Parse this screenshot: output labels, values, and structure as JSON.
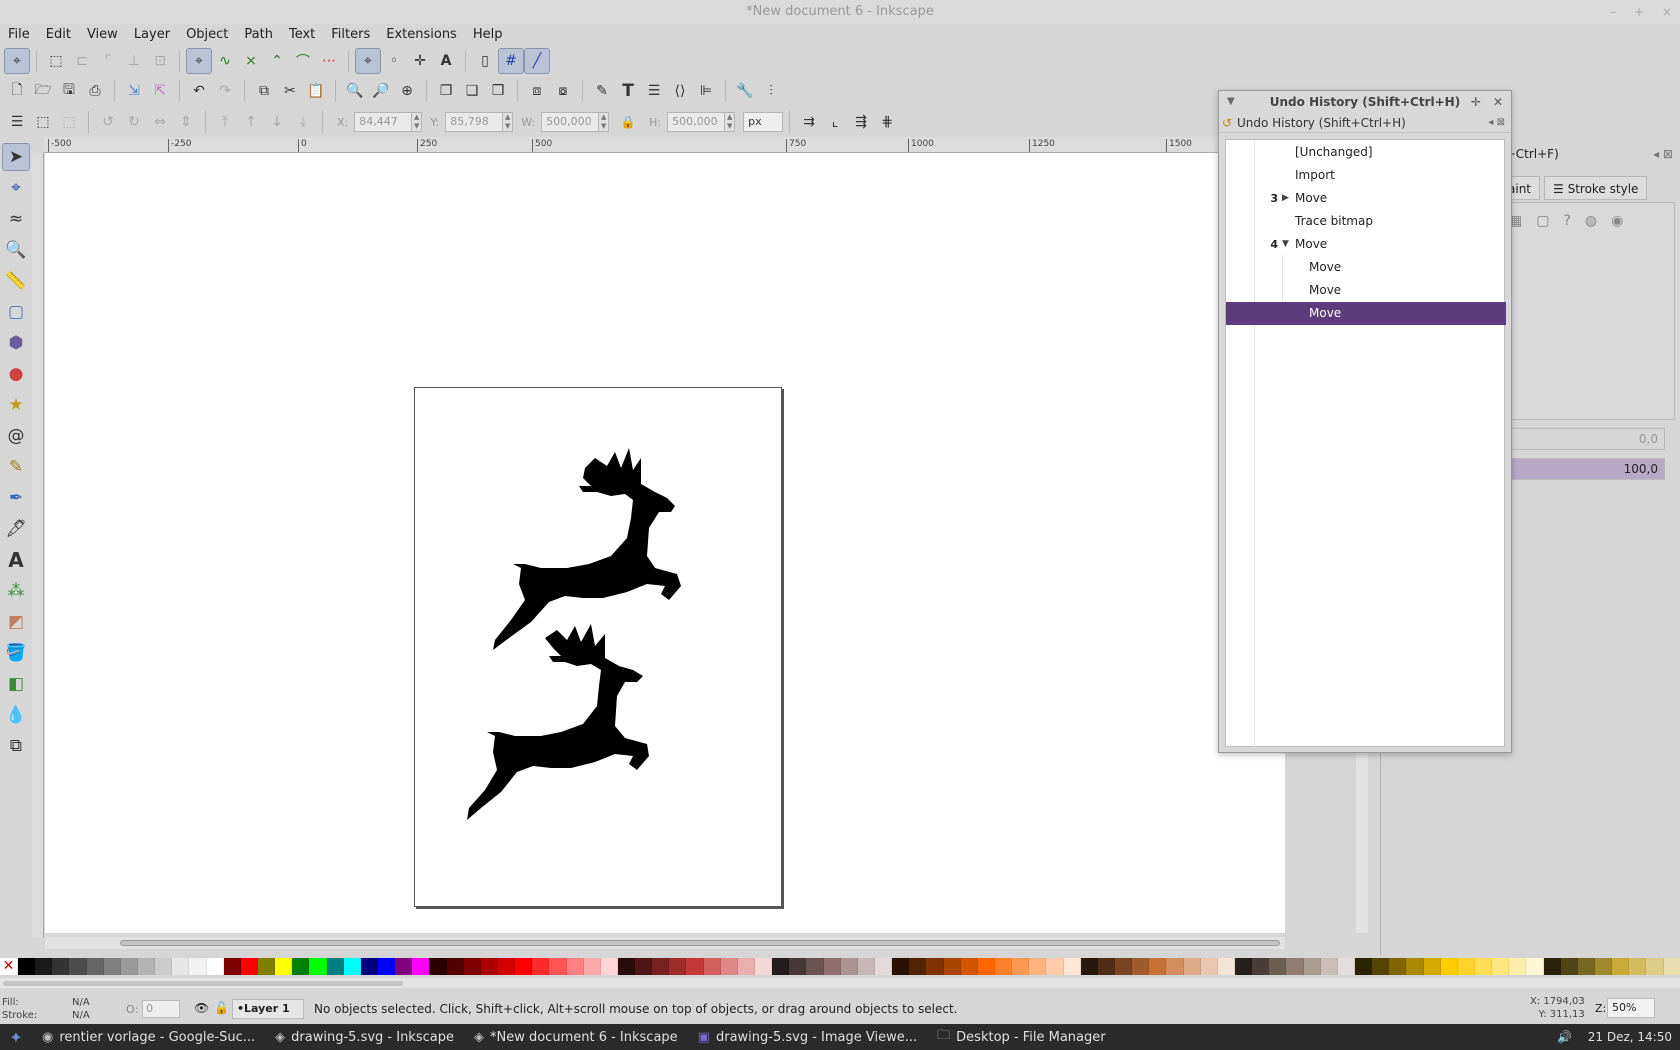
{
  "window": {
    "title": "*New document 6 - Inkscape",
    "controls": [
      "–",
      "+",
      "×"
    ]
  },
  "menubar": [
    "File",
    "Edit",
    "View",
    "Layer",
    "Object",
    "Path",
    "Text",
    "Filters",
    "Extensions",
    "Help"
  ],
  "node_toolbar_icons": [
    "node-select-icon",
    "insert-node-icon",
    "add-node-icon",
    "delete-node-icon",
    "join-nodes-icon",
    "break-path-icon",
    "cusp-node-icon",
    "smooth-node-icon",
    "symmetric-node-icon",
    "auto-node-icon",
    "line-segment-icon",
    "curve-segment-icon",
    "show-handles-icon",
    "show-outline-icon",
    "show-clip-icon",
    "text-icon"
  ],
  "selector_toolbar": {
    "x_label": "X:",
    "x_value": "84,447",
    "y_label": "Y:",
    "y_value": "85,798",
    "w_label": "W:",
    "w_value": "500,000",
    "h_label": "H:",
    "h_value": "500,000",
    "unit": "px"
  },
  "ruler": {
    "ticks": [
      "-500",
      "-250",
      "0",
      "250",
      "500",
      "750",
      "1000",
      "1250",
      "1500"
    ]
  },
  "undo_history": {
    "window_title": "Undo History (Shift+Ctrl+H)",
    "dock_title": "Undo History (Shift+Ctrl+H)",
    "items": [
      {
        "label": "[Unchanged]",
        "count": "",
        "expander": "",
        "indent": false,
        "selected": false
      },
      {
        "label": "Import",
        "count": "",
        "expander": "",
        "indent": false,
        "selected": false
      },
      {
        "label": "Move",
        "count": "3",
        "expander": "▶",
        "indent": false,
        "selected": false
      },
      {
        "label": "Trace bitmap",
        "count": "",
        "expander": "",
        "indent": false,
        "selected": false
      },
      {
        "label": "Move",
        "count": "4",
        "expander": "▼",
        "indent": false,
        "selected": false
      },
      {
        "label": "Move",
        "count": "",
        "expander": "",
        "indent": true,
        "selected": false
      },
      {
        "label": "Move",
        "count": "",
        "expander": "",
        "indent": true,
        "selected": false
      },
      {
        "label": "Move",
        "count": "",
        "expander": "",
        "indent": true,
        "selected": true
      }
    ]
  },
  "fill_stroke_panel": {
    "title_fragment": "t+Ctrl+F)",
    "tab_fill_fragment": "aint",
    "tab_stroke": "Stroke style",
    "blur_value": "0,0",
    "opacity_value": "100,0"
  },
  "statusbar": {
    "fill_label": "Fill:",
    "fill_value": "N/A",
    "stroke_label": "Stroke:",
    "stroke_value": "N/A",
    "opacity_label": "O:",
    "opacity_value": "0",
    "layer": "•Layer 1",
    "message": "No objects selected. Click, Shift+click, Alt+scroll mouse on top of objects, or drag around objects to select.",
    "cursor_x": "X: 1794,03",
    "cursor_y": "Y:  311,13",
    "zoom_label": "Z:",
    "zoom": "50%"
  },
  "taskbar": {
    "tasks": [
      {
        "label": "rentier vorlage - Google-Suc...",
        "icon": "browser-icon"
      },
      {
        "label": "drawing-5.svg - Inkscape",
        "icon": "inkscape-icon"
      },
      {
        "label": "*New document 6 - Inkscape",
        "icon": "inkscape-icon"
      },
      {
        "label": "drawing-5.svg - Image Viewe...",
        "icon": "image-viewer-icon"
      },
      {
        "label": "Desktop - File Manager",
        "icon": "folder-icon"
      }
    ],
    "clock": "21 Dez, 14:50"
  },
  "palette_colors": [
    "#000000",
    "#1a1a1a",
    "#333333",
    "#4d4d4d",
    "#666666",
    "#808080",
    "#999999",
    "#b3b3b3",
    "#cccccc",
    "#e6e6e6",
    "#f2f2f2",
    "#ffffff",
    "#800000",
    "#ff0000",
    "#808000",
    "#ffff00",
    "#008000",
    "#00ff00",
    "#008080",
    "#00ffff",
    "#000080",
    "#0000ff",
    "#800080",
    "#ff00ff",
    "#2b0000",
    "#550000",
    "#800000",
    "#aa0000",
    "#d40000",
    "#ff0000",
    "#ff2a2a",
    "#ff5555",
    "#ff8080",
    "#ffaaaa",
    "#ffd5d5",
    "#280b0b",
    "#501616",
    "#782121",
    "#a02c2c",
    "#c83737",
    "#d35f5f",
    "#de8787",
    "#e9afaf",
    "#f4d7d7",
    "#241c1c",
    "#483737",
    "#6c5353",
    "#916f6f",
    "#ac9393",
    "#c8b7b7",
    "#e3dbdb",
    "#2b1100",
    "#552200",
    "#803300",
    "#aa4400",
    "#d45500",
    "#ff6600",
    "#ff7f2a",
    "#ff9955",
    "#ffb380",
    "#ffccaa",
    "#ffe6d5",
    "#28170b",
    "#502d16",
    "#784421",
    "#a05a2c",
    "#c87137",
    "#d38d5f",
    "#deaa87",
    "#e9c6af",
    "#f4e3d7",
    "#241f1c",
    "#483e37",
    "#6c5d53",
    "#917c6f",
    "#ac9d93",
    "#c8beb7",
    "#e3dedb",
    "#2b2200",
    "#554400",
    "#806600",
    "#aa8800",
    "#d4aa00",
    "#ffcc00",
    "#ffd42a",
    "#ffdd55",
    "#ffe680",
    "#ffeeaa",
    "#fff6d5",
    "#28220b",
    "#504416",
    "#786721",
    "#a0892c",
    "#c8ab37",
    "#d3bc5f",
    "#decd87",
    "#e9ddaf"
  ]
}
